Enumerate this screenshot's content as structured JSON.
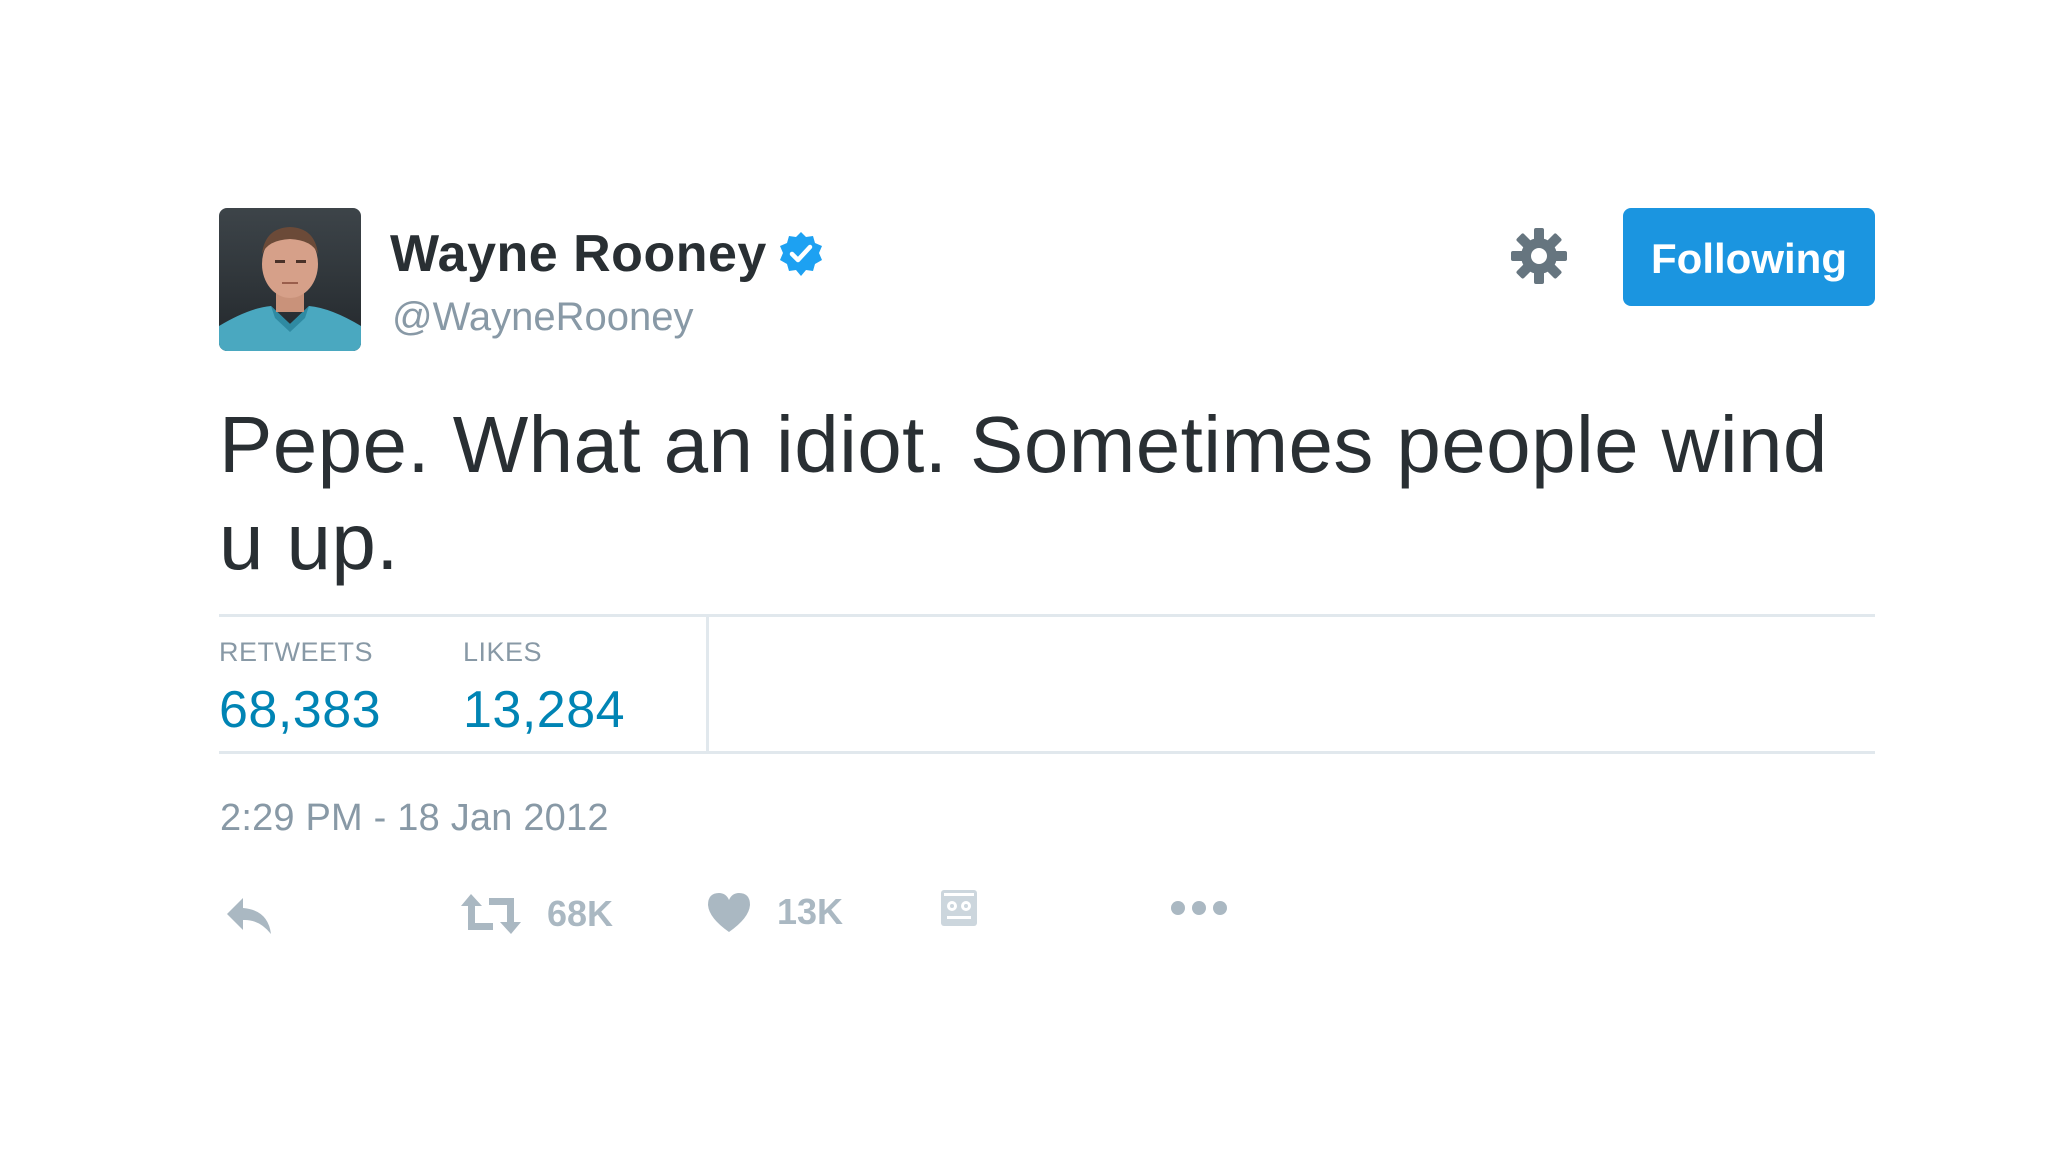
{
  "user": {
    "display_name": "Wayne Rooney",
    "handle": "@WayneRooney",
    "verified": true
  },
  "header": {
    "follow_button_label": "Following"
  },
  "tweet": {
    "text": "Pepe. What an idiot. Sometimes people wind u up.",
    "timestamp": "2:29 PM - 18 Jan 2012"
  },
  "stats": {
    "retweets_label": "RETWEETS",
    "retweets_value": "68,383",
    "likes_label": "LIKES",
    "likes_value": "13,284"
  },
  "actions": {
    "retweet_count": "68K",
    "like_count": "13K"
  },
  "icons": {
    "verified": "verified-badge-icon",
    "settings": "gear-icon",
    "reply": "reply-icon",
    "retweet": "retweet-icon",
    "like": "heart-icon",
    "analytics": "analytics-icon",
    "more": "more-dots-icon"
  },
  "colors": {
    "accent_blue": "#1b95e0",
    "verified_blue": "#1da1f2",
    "stat_value": "#0084b4",
    "text_primary": "#292f33",
    "text_secondary": "#8899a6",
    "action_gray": "#aab8c2"
  }
}
